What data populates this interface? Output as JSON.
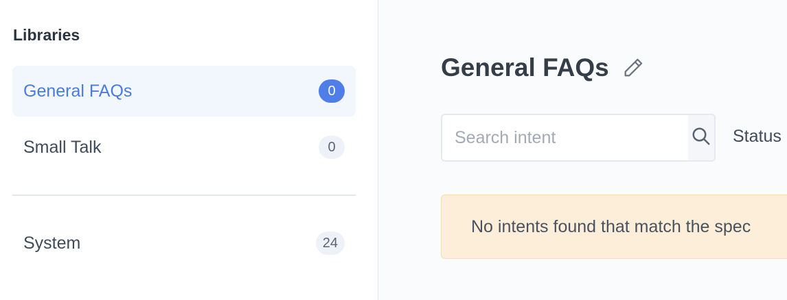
{
  "sidebar": {
    "title": "Libraries",
    "items": [
      {
        "label": "General FAQs",
        "count": "0",
        "active": true
      },
      {
        "label": "Small Talk",
        "count": "0",
        "active": false
      },
      {
        "label": "System",
        "count": "24",
        "active": false
      }
    ]
  },
  "main": {
    "title": "General FAQs",
    "search": {
      "placeholder": "Search intent",
      "value": ""
    },
    "status_label": "Status",
    "empty_message": "No intents found that match the spec"
  },
  "colors": {
    "accent": "#4f7ee8",
    "active_text": "#4a7ce0",
    "alert_bg": "#fdeed9"
  },
  "icons": {
    "edit": "pencil-icon",
    "search": "search-icon"
  }
}
